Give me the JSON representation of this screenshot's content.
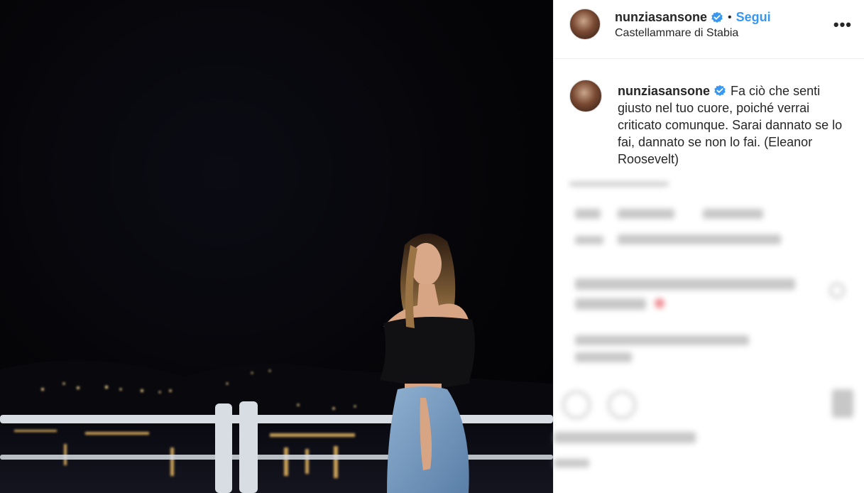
{
  "header": {
    "username": "nunziasansone",
    "separator": "•",
    "follow_label": "Segui",
    "location": "Castellammare di Stabia",
    "more_label": "•••"
  },
  "caption": {
    "username": "nunziasansone",
    "text": "Fa ciò che senti giusto nel tuo cuore, poiché verrai criticato comunque. Sarai dannato se lo fai, dannato se non lo fai. (Eleanor Roosevelt)"
  },
  "icons": {
    "verified": "verified-badge-icon",
    "more": "more-options-icon"
  },
  "colors": {
    "accent": "#3897f0",
    "verified": "#3897f0",
    "text": "#262626",
    "border": "#efefef"
  }
}
